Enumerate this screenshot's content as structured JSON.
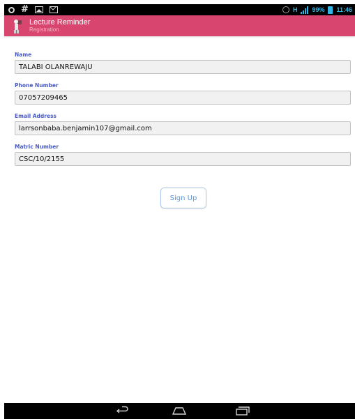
{
  "status_bar": {
    "battery_percent": "99%",
    "time": "11:46",
    "signal_type": "H",
    "icons": [
      "circle-icon",
      "hash-icon",
      "picture-icon",
      "mail-icon",
      "alarm-icon",
      "signal-icon",
      "battery-icon"
    ],
    "accent_color": "#33b5e5"
  },
  "action_bar": {
    "title": "Lecture Reminder",
    "subtitle": "Registration",
    "background_color": "#d8456f",
    "icon": "app-icon"
  },
  "form": {
    "name": {
      "label": "Name",
      "value": "TALABI OLANREWAJU"
    },
    "phone": {
      "label": "Phone Number",
      "value": "07057209465"
    },
    "email": {
      "label": "Email Address",
      "value": "larrsonbaba.benjamin107@gmail.com"
    },
    "matric": {
      "label": "Matric Number",
      "value": "CSC/10/2155"
    },
    "label_color": "#4a5bc4"
  },
  "signup_button": {
    "label": "Sign Up",
    "text_color": "#5f93d6"
  },
  "nav_bar": {
    "icons": [
      "back-icon",
      "home-icon",
      "recent-apps-icon"
    ]
  }
}
